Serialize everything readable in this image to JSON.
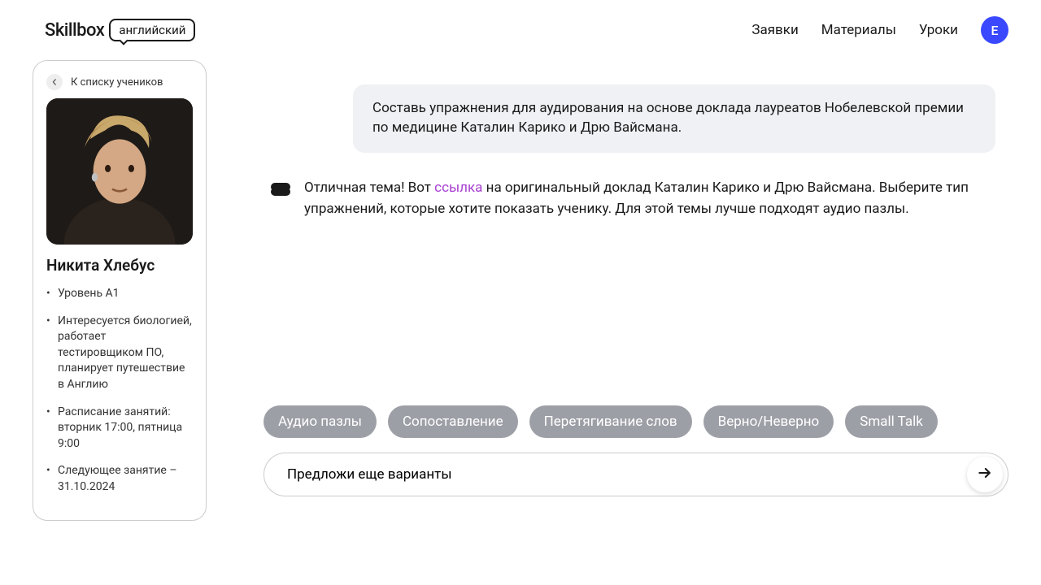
{
  "logo": {
    "brand": "Skillbox",
    "tag": "английский"
  },
  "nav": {
    "requests": "Заявки",
    "materials": "Материалы",
    "lessons": "Уроки"
  },
  "avatar_initial": "E",
  "sidebar": {
    "back": "К списку учеников",
    "student_name": "Никита Хлебус",
    "details": [
      "Уровень A1",
      "Интересуется биологией, работает тестировщиком ПО, планирует путешествие в Англию",
      "Расписание занятий: вторник 17:00, пятница 9:00",
      "Следующее занятие – 31.10.2024"
    ]
  },
  "chat": {
    "user_message": "Составь упражнения для аудирования на основе доклада лауреатов Нобелевской премии по  медицине Каталин Карико и Дрю Вайсмана.",
    "ai_pre": "Отличная тема! Вот ",
    "ai_link": "ссылка",
    "ai_post": " на оригинальный доклад Каталин Карико и Дрю Вайсмана. Выберите тип упражнений, которые хотите показать ученику. Для этой темы лучше подходят аудио пазлы."
  },
  "chips": {
    "audio_puzzles": "Аудио пазлы",
    "matching": "Сопоставление",
    "drag_words": "Перетягивание слов",
    "true_false": "Верно/Неверно",
    "small_talk": "Small Talk"
  },
  "input": {
    "value": "Предложи еще варианты "
  }
}
